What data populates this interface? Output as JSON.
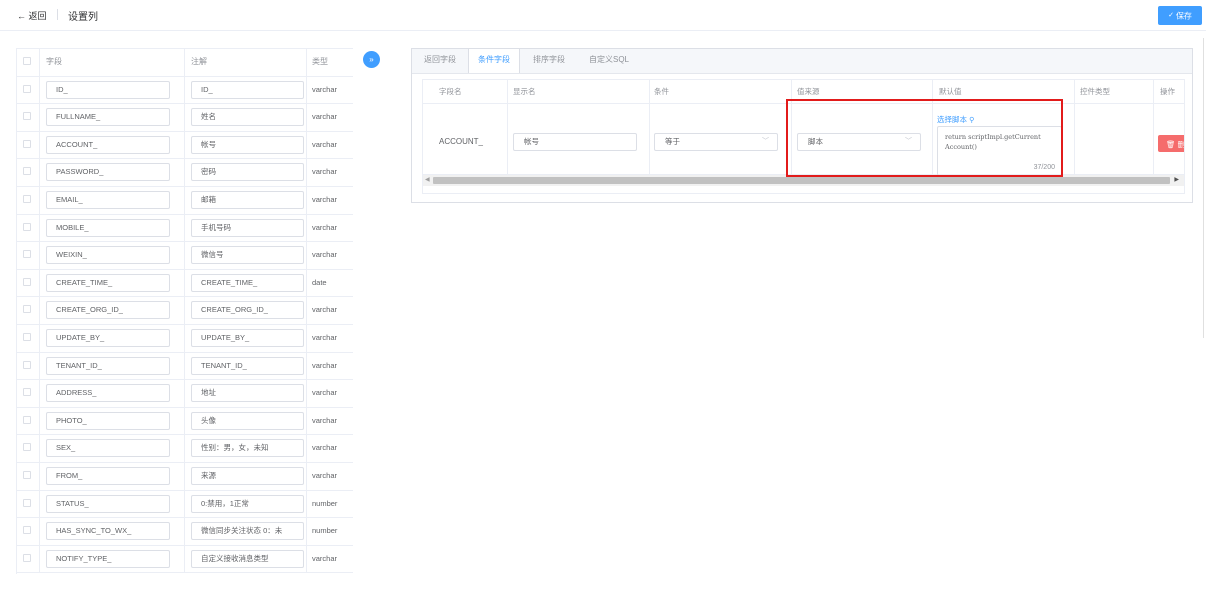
{
  "header": {
    "back_label": "← 返回",
    "title": "设置列",
    "save_label": "保存",
    "save_icon": "check-icon"
  },
  "field_table": {
    "columns": [
      "字段",
      "注解",
      "类型"
    ],
    "rows": [
      {
        "field": "ID_",
        "comment": "ID_",
        "type": "varchar"
      },
      {
        "field": "FULLNAME_",
        "comment": "姓名",
        "type": "varchar"
      },
      {
        "field": "ACCOUNT_",
        "comment": "帐号",
        "type": "varchar"
      },
      {
        "field": "PASSWORD_",
        "comment": "密码",
        "type": "varchar"
      },
      {
        "field": "EMAIL_",
        "comment": "邮箱",
        "type": "varchar"
      },
      {
        "field": "MOBILE_",
        "comment": "手机号码",
        "type": "varchar"
      },
      {
        "field": "WEIXIN_",
        "comment": "微信号",
        "type": "varchar"
      },
      {
        "field": "CREATE_TIME_",
        "comment": "CREATE_TIME_",
        "type": "date"
      },
      {
        "field": "CREATE_ORG_ID_",
        "comment": "CREATE_ORG_ID_",
        "type": "varchar"
      },
      {
        "field": "UPDATE_BY_",
        "comment": "UPDATE_BY_",
        "type": "varchar"
      },
      {
        "field": "TENANT_ID_",
        "comment": "TENANT_ID_",
        "type": "varchar"
      },
      {
        "field": "ADDRESS_",
        "comment": "地址",
        "type": "varchar"
      },
      {
        "field": "PHOTO_",
        "comment": "头像",
        "type": "varchar"
      },
      {
        "field": "SEX_",
        "comment": "性别：男，女，未知",
        "type": "varchar"
      },
      {
        "field": "FROM_",
        "comment": "来源",
        "type": "varchar"
      },
      {
        "field": "STATUS_",
        "comment": "0:禁用，1正常",
        "type": "number"
      },
      {
        "field": "HAS_SYNC_TO_WX_",
        "comment": "微信同步关注状态 0：未",
        "type": "number"
      },
      {
        "field": "NOTIFY_TYPE_",
        "comment": "自定义接收消息类型",
        "type": "varchar"
      }
    ]
  },
  "expand_button": {
    "icon": "double-chevron-right-icon",
    "label": "»"
  },
  "tabs": [
    {
      "label": "返回字段",
      "active": false
    },
    {
      "label": "条件字段",
      "active": true
    },
    {
      "label": "排序字段",
      "active": false
    },
    {
      "label": "自定义SQL",
      "active": false
    }
  ],
  "condition_table": {
    "columns": [
      "字段名",
      "显示名",
      "条件",
      "值来源",
      "默认值",
      "控件类型",
      "操作"
    ],
    "row": {
      "field": "ACCOUNT_",
      "display_name": "帐号",
      "condition": "等于",
      "value_source": "脚本",
      "select_script_label": "选择脚本",
      "script_line1": "return scriptImpl.getCurrent",
      "script_line2": "Account()",
      "counter": "37/200",
      "delete_label": "删除"
    }
  },
  "colors": {
    "primary": "#409eff",
    "danger": "#f56c6c",
    "highlight": "#e21b1b"
  }
}
